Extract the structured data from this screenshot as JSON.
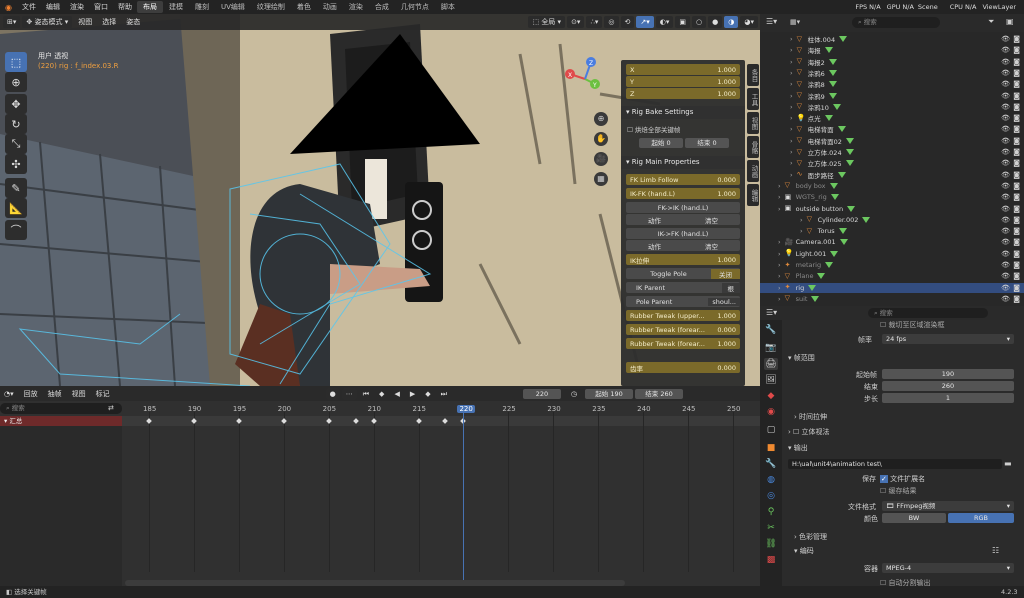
{
  "topbar": {
    "menus": [
      "文件",
      "编辑",
      "渲染",
      "窗口",
      "帮助"
    ],
    "workspaces": [
      "布局",
      "建模",
      "雕刻",
      "UV编辑",
      "纹理绘制",
      "着色",
      "动画",
      "渲染",
      "合成",
      "几何节点",
      "脚本"
    ],
    "active_workspace": "布局",
    "fps_label": "FPS",
    "fps_value": "N/A",
    "gpu_label": "GPU",
    "gpu_value": "N/A",
    "cpu_label": "CPU",
    "cpu_value": "N/A",
    "scene": "Scene",
    "view_layer": "ViewLayer"
  },
  "viewport": {
    "mode": "姿态模式",
    "menus": [
      "视图",
      "选择",
      "姿态"
    ],
    "transform_orientation": "全局",
    "pose_options": "姿态选项",
    "view_name": "用户 透视",
    "object_info": "(220) rig : f_index.03.R",
    "gizmo_axes": [
      "X",
      "Y",
      "Z"
    ]
  },
  "npanel": {
    "xyz": [
      {
        "label": "X",
        "value": "1.000"
      },
      {
        "label": "Y",
        "value": "1.000"
      },
      {
        "label": "Z",
        "value": "1.000"
      }
    ],
    "rig_bake_settings": {
      "title": "Rig Bake Settings",
      "checkbox_label": "烘焙全部关键帧",
      "start_label": "起始",
      "start_value": "0",
      "end_label": "结束",
      "end_value": "0"
    },
    "rig_main": {
      "title": "Rig Main Properties",
      "fk_limb_follow": {
        "label": "FK Limb Follow",
        "value": "0.000"
      },
      "ik_fk": {
        "label": "IK-FK (hand.L)",
        "value": "1.000"
      },
      "fk_to_ik": "FK->IK (hand.L)",
      "action_label": "动作",
      "clear_label": "清空",
      "ik_to_fk": "IK->FK (hand.L)",
      "ik_stretch": {
        "label": "IK拉伸",
        "value": "1.000"
      },
      "toggle_pole": "Toggle Pole",
      "toggle_pole_value": "关闭",
      "ik_parent_label": "IK Parent",
      "ik_parent_value": "根",
      "pole_parent_label": "Pole Parent",
      "pole_parent_value": "shoul...",
      "rubber1": {
        "label": "Rubber Tweak (upper...",
        "value": "1.000"
      },
      "rubber2": {
        "label": "Rubber Tweak (forear...",
        "value": "0.000"
      },
      "rubber3": {
        "label": "Rubber Tweak (forear...",
        "value": "1.000"
      },
      "smooth": {
        "label": "齿率",
        "value": "0.000"
      }
    },
    "side_tabs": [
      "条目",
      "工具",
      "视图",
      "骨骼",
      "动画",
      "编辑"
    ]
  },
  "outliner": {
    "search_placeholder": "搜索",
    "items": [
      {
        "name": "柱体.004",
        "icon": "mesh-icon"
      },
      {
        "name": "海报",
        "icon": "mesh-icon"
      },
      {
        "name": "海报2",
        "icon": "mesh-icon"
      },
      {
        "name": "涂鸦6",
        "icon": "mesh-icon"
      },
      {
        "name": "涂鸦8",
        "icon": "mesh-icon"
      },
      {
        "name": "涂鸦9",
        "icon": "mesh-icon"
      },
      {
        "name": "涂鸦10",
        "icon": "mesh-icon"
      },
      {
        "name": "点光",
        "icon": "light-icon"
      },
      {
        "name": "电梯背面",
        "icon": "mesh-icon"
      },
      {
        "name": "电梯背面02",
        "icon": "mesh-icon"
      },
      {
        "name": "立方体.024",
        "icon": "mesh-icon"
      },
      {
        "name": "立方体.025",
        "icon": "mesh-icon"
      },
      {
        "name": "面步路径",
        "icon": "curve-icon"
      },
      {
        "name": "body box",
        "icon": "mesh-icon"
      },
      {
        "name": "WGTS_rig",
        "icon": "collection-icon"
      },
      {
        "name": "outside button",
        "icon": "collection-icon"
      },
      {
        "name": "Cylinder.002",
        "icon": "mesh-icon"
      },
      {
        "name": "Torus",
        "icon": "mesh-icon"
      },
      {
        "name": "Camera.001",
        "icon": "camera-icon"
      },
      {
        "name": "Light.001",
        "icon": "light-icon"
      },
      {
        "name": "metarig",
        "icon": "armature-icon"
      },
      {
        "name": "Plane",
        "icon": "mesh-icon"
      },
      {
        "name": "rig",
        "icon": "armature-icon"
      },
      {
        "name": "suit",
        "icon": "mesh-icon"
      }
    ],
    "selected": "rig"
  },
  "properties": {
    "search_placeholder": "搜索",
    "crop_label": "裁切至区域渲染框",
    "frame_rate_label": "帧率",
    "frame_rate_value": "24 fps",
    "frame_range_title": "帧范围",
    "start_label": "起始帧",
    "start_value": "190",
    "end_label": "结束",
    "end_value": "260",
    "step_label": "步长",
    "step_value": "1",
    "time_stretch_title": "时间拉伸",
    "stereo_title": "立体视法",
    "output_title": "输出",
    "output_path": "H:\\ual\\unit4\\animation test\\",
    "save_label": "保存",
    "file_ext_label": "文件扩展名",
    "cache_label": "缓存结果",
    "file_format_label": "文件格式",
    "file_format_value": "FFmpeg视频",
    "color_label": "颜色",
    "bw_label": "BW",
    "rgb_label": "RGB",
    "color_mgmt_title": "色彩管理",
    "encoding_title": "编码",
    "container_label": "容器",
    "container_value": "MPEG-4",
    "autosplit_label": "自动分割输出"
  },
  "timeline": {
    "menus": [
      "回放",
      "抽帧",
      "视图",
      "标记"
    ],
    "current_frame": "220",
    "start_label": "起始",
    "start_value": "190",
    "end_label": "结束",
    "end_value": "260",
    "search_placeholder": "搜索",
    "summary_label": "汇总",
    "ticks": [
      "185",
      "190",
      "195",
      "200",
      "205",
      "210",
      "215",
      "220",
      "225",
      "230",
      "235",
      "240",
      "245",
      "250"
    ],
    "keyframes": [
      185,
      190,
      195,
      200,
      205,
      208,
      210,
      215,
      218,
      220
    ]
  },
  "status": {
    "left": "选择关键帧",
    "version": "4.2.3"
  },
  "colors": {
    "accent": "#4772b3",
    "slider": "#7b6a2a",
    "playhead": "#4772b3",
    "summary": "#6e2a2a"
  }
}
